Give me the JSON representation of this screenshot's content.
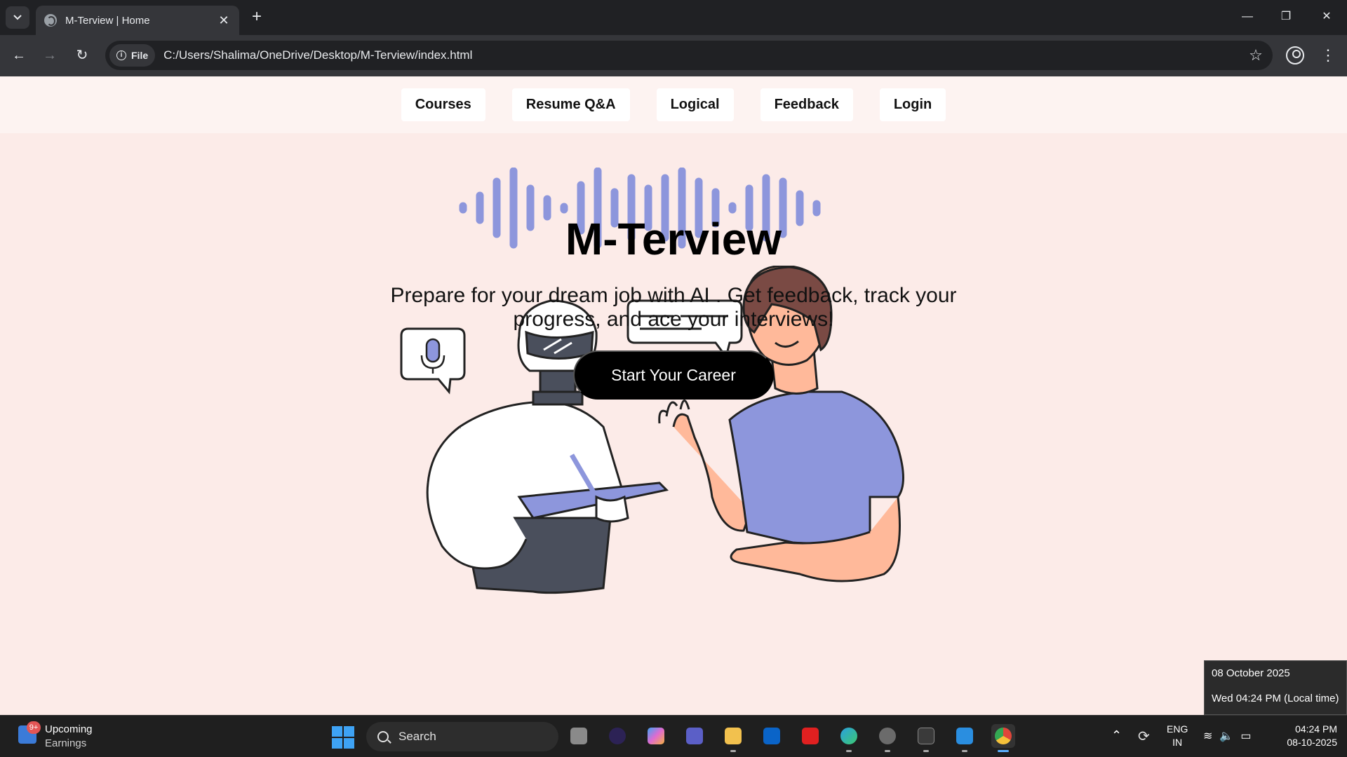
{
  "browser": {
    "tab_title": "M-Terview | Home",
    "new_tab": "+",
    "site_chip": "File",
    "url": "C:/Users/Shalima/OneDrive/Desktop/M-Terview/index.html"
  },
  "site": {
    "nav": [
      "Courses",
      "Resume Q&A",
      "Logical",
      "Feedback",
      "Login"
    ],
    "title": "M-Terview",
    "subtitle": "Prepare for your dream job with AI . Get feedback, track your progress, and ace your interviews!",
    "cta": "Start Your Career"
  },
  "tooltip": {
    "date": "08 October 2025",
    "time": "Wed 04:24 PM (Local time)"
  },
  "taskbar": {
    "widget_badge": "9+",
    "widget_title": "Upcoming",
    "widget_subtitle": "Earnings",
    "search_placeholder": "Search",
    "lang_top": "ENG",
    "lang_bottom": "IN",
    "clock_time": "04:24 PM",
    "clock_date": "08-10-2025"
  },
  "colors": {
    "accent": "#8d96dc",
    "page_bg": "#fcebe8",
    "nav_bg": "#fdf3f1",
    "cta_bg": "#000000"
  }
}
